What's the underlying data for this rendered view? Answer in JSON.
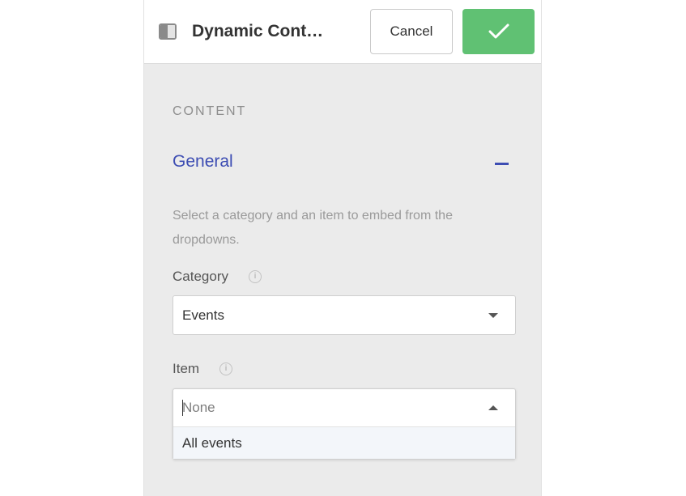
{
  "header": {
    "title": "Dynamic Cont…",
    "panel_icon": "sidebar-panel-icon",
    "cancel_label": "Cancel",
    "confirm_icon": "checkmark-icon"
  },
  "content": {
    "section_label": "CONTENT",
    "group": {
      "title": "General",
      "toggle_icon": "minus-icon",
      "help_text": "Select a category and an item to embed from the dropdowns."
    },
    "fields": {
      "category": {
        "label": "Category",
        "info_icon": "info-icon",
        "selected_value": "Events"
      },
      "item": {
        "label": "Item",
        "info_icon": "info-icon",
        "value": "",
        "placeholder": "None",
        "options": [
          "All events"
        ]
      }
    }
  },
  "colors": {
    "accent": "#3d4db3",
    "confirm": "#60c173",
    "panel_background": "#ebebeb"
  }
}
